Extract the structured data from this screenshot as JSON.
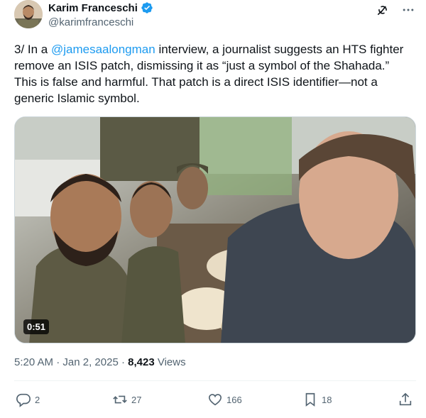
{
  "author": {
    "display_name": "Karim Franceschi",
    "handle": "@karimfranceschi",
    "verified": true
  },
  "tweet": {
    "text_before_mention": "3/ In a ",
    "mention": "@jamesaalongman",
    "text_after_mention": " interview, a journalist suggests an HTS fighter remove an ISIS patch, dismissing it as “just a symbol of the Shahada.” This is false and harmful. That patch is a direct ISIS identifier—not a generic Islamic symbol."
  },
  "media": {
    "duration": "0:51"
  },
  "meta": {
    "time": "5:20 AM",
    "separator1": " · ",
    "date": "Jan 2, 2025",
    "separator2": " · ",
    "views_count": "8,423",
    "views_label": " Views"
  },
  "actions": {
    "replies": "2",
    "reposts": "27",
    "likes": "166",
    "bookmarks": "18"
  },
  "icons": {
    "verified": "verified-badge-icon",
    "grok": "grok-icon",
    "more": "more-icon",
    "reply": "reply-icon",
    "repost": "repost-icon",
    "like": "like-icon",
    "bookmark": "bookmark-icon",
    "share": "share-icon"
  },
  "colors": {
    "accent": "#1d9bf0",
    "text": "#0f1419",
    "secondary": "#536471"
  }
}
